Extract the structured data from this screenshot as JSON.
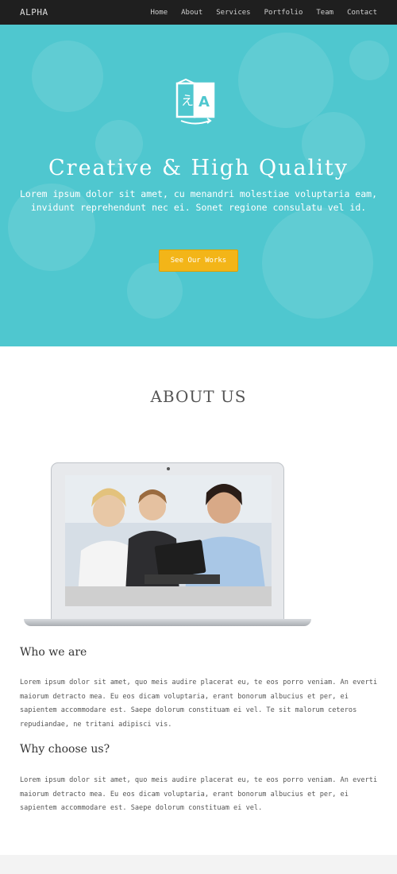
{
  "navbar": {
    "brand": "ALPHA",
    "links": [
      "Home",
      "About",
      "Services",
      "Portfolio",
      "Team",
      "Contact"
    ]
  },
  "hero": {
    "title": "Creative & High Quality",
    "text_line1": "Lorem ipsum dolor sit amet, cu menandri molestiae voluptaria eam,",
    "text_line2": "invidunt reprehendunt nec ei. Sonet regione consulatu vel id.",
    "cta_label": "See Our Works",
    "logo_icon": "translate-icon",
    "logo_glyphs": [
      "え",
      "A"
    ]
  },
  "about": {
    "title": "ABOUT US",
    "image_icon": "laptop-team-photo",
    "who_heading": "Who we are",
    "who_text": "Lorem ipsum dolor sit amet, quo meis audire placerat eu, te eos porro veniam. An everti maiorum detracto mea. Eu eos dicam voluptaria, erant bonorum albucius et per, ei sapientem accommodare est. Saepe dolorum constituam ei vel. Te sit malorum ceteros repudiandae, ne tritani adipisci vis.",
    "why_heading": "Why choose us?",
    "why_text": "Lorem ipsum dolor sit amet, quo meis audire placerat eu, te eos porro veniam. An everti maiorum detracto mea. Eu eos dicam voluptaria, erant bonorum albucius et per, ei sapientem accommodare est. Saepe dolorum constituam ei vel."
  },
  "colors": {
    "hero_bg": "#4fc7cf",
    "navbar_bg": "#1f1f1f",
    "cta_bg": "#f3b518"
  }
}
